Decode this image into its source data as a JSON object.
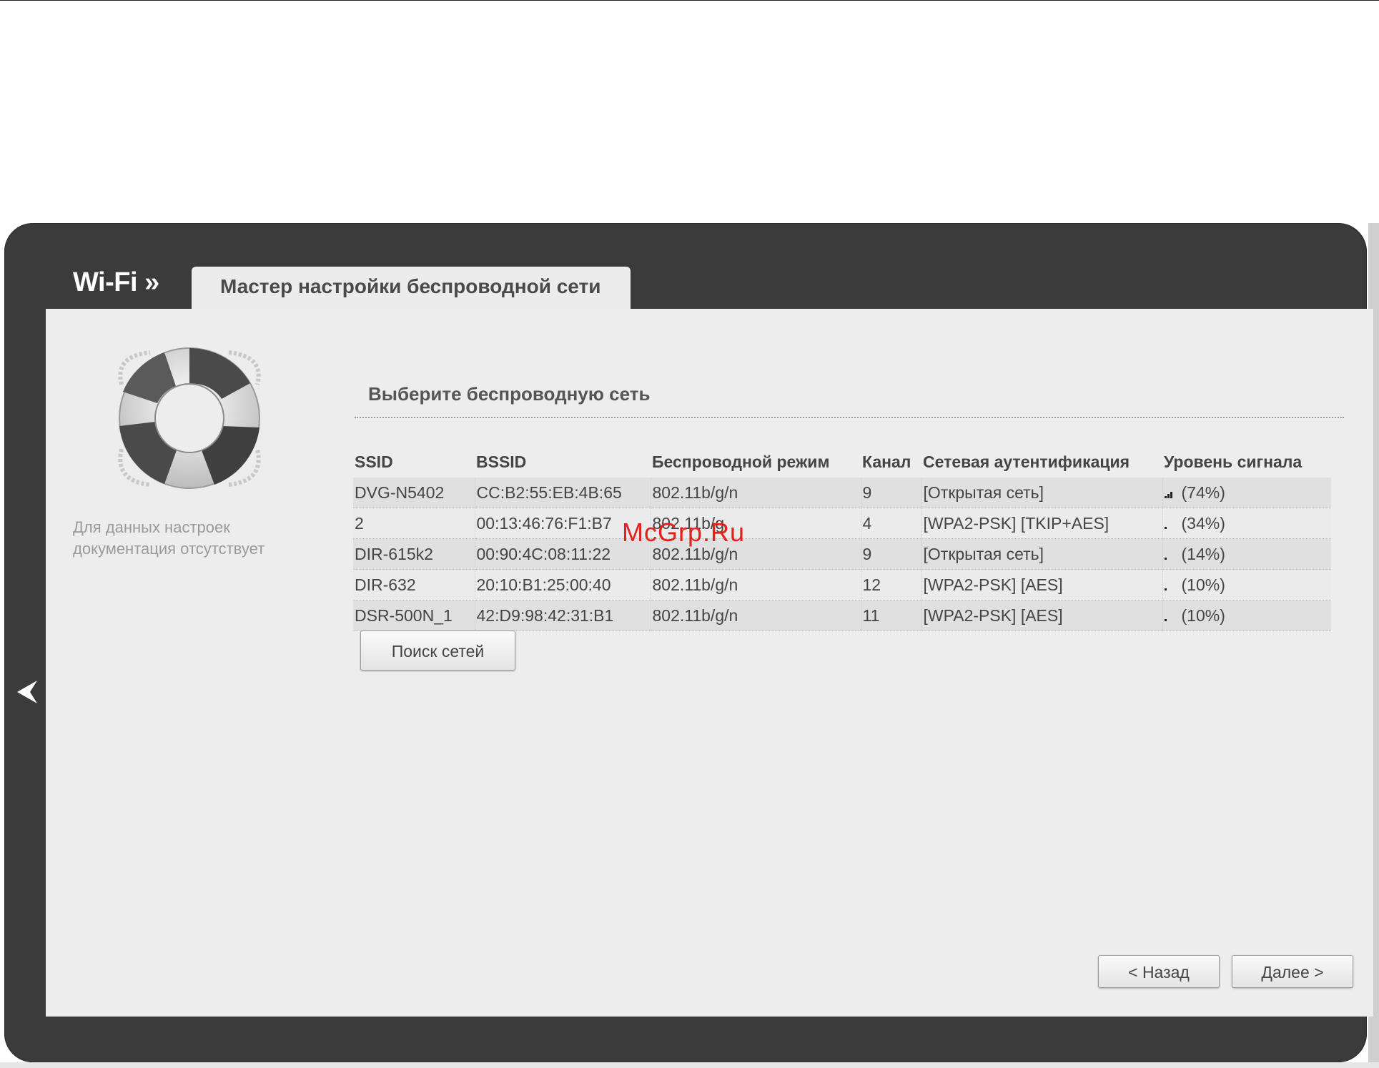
{
  "header": {
    "section": "Wi-Fi »",
    "tab": "Мастер настройки беспроводной сети"
  },
  "sidebar": {
    "doc_note": "Для данных настроек документация отсутствует"
  },
  "main": {
    "title": "Выберите беспроводную сеть",
    "table": {
      "columns": [
        "SSID",
        "BSSID",
        "Беспроводной режим",
        "Канал",
        "Сетевая аутентификация",
        "Уровень сигнала"
      ],
      "rows": [
        {
          "ssid": "DVG-N5402",
          "bssid": "CC:B2:55:EB:4B:65",
          "mode": "802.11b/g/n",
          "channel": "9",
          "auth": "[Открытая сеть]",
          "signal": "(74%)",
          "signal_pct": 74
        },
        {
          "ssid": "2",
          "bssid": "00:13:46:76:F1:B7",
          "mode": "802.11b/g",
          "channel": "4",
          "auth": "[WPA2-PSK] [TKIP+AES]",
          "signal": "(34%)",
          "signal_pct": 34
        },
        {
          "ssid": "DIR-615k2",
          "bssid": "00:90:4C:08:11:22",
          "mode": "802.11b/g/n",
          "channel": "9",
          "auth": "[Открытая сеть]",
          "signal": "(14%)",
          "signal_pct": 14
        },
        {
          "ssid": "DIR-632",
          "bssid": "20:10:B1:25:00:40",
          "mode": "802.11b/g/n",
          "channel": "12",
          "auth": "[WPA2-PSK] [AES]",
          "signal": "(10%)",
          "signal_pct": 10
        },
        {
          "ssid": "DSR-500N_1",
          "bssid": "42:D9:98:42:31:B1",
          "mode": "802.11b/g/n",
          "channel": "11",
          "auth": "[WPA2-PSK] [AES]",
          "signal": "(10%)",
          "signal_pct": 10
        }
      ]
    },
    "scan_button": "Поиск сетей"
  },
  "footer": {
    "back_button": "< Назад",
    "next_button": "Далее >"
  },
  "watermark": "McGrp.Ru",
  "colors": {
    "frame": "#3b3b3b",
    "panel": "#ededed",
    "watermark": "#e3201b"
  },
  "icons": {
    "back_arrow": "chevron-left-icon",
    "help": "lifebuoy-icon",
    "signal": "signal-bars-icon"
  }
}
